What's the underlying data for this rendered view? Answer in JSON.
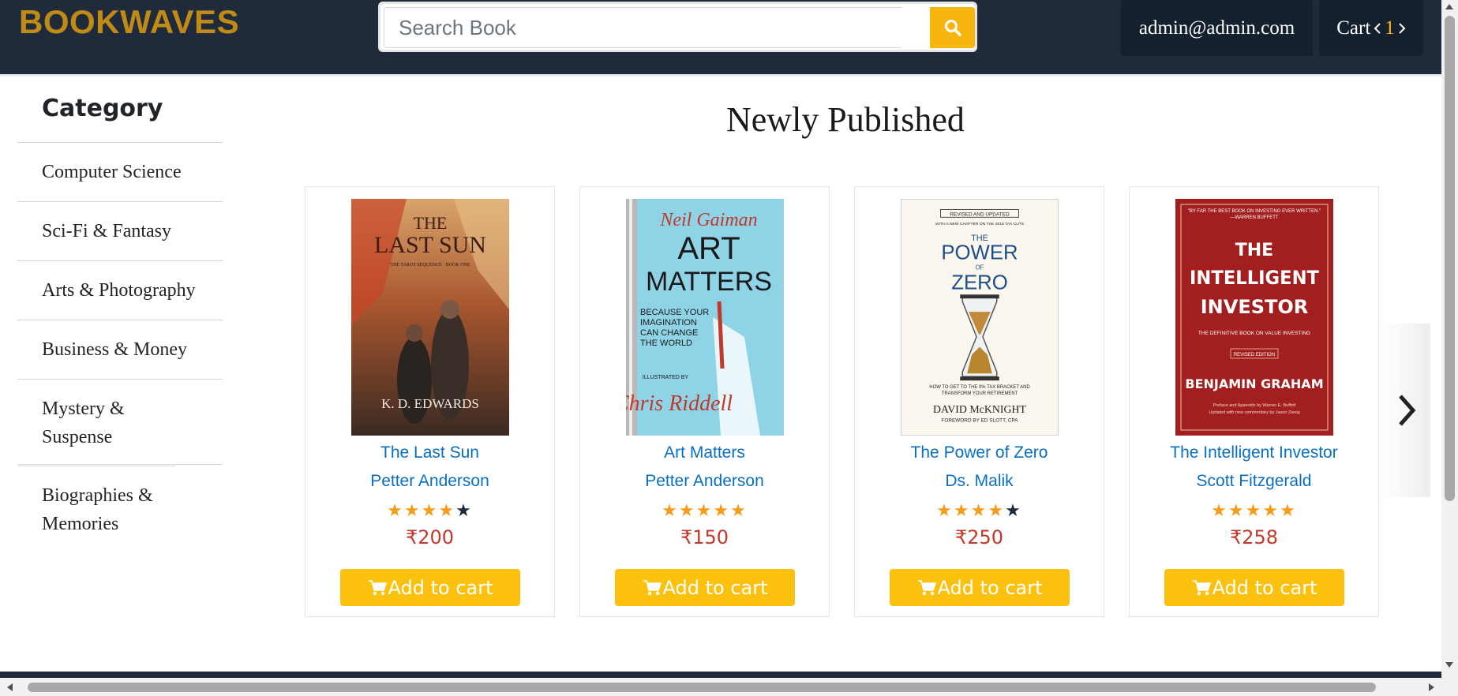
{
  "header": {
    "logo": "BOOKWAVES",
    "search_placeholder": "Search Book",
    "user_email": "admin@admin.com",
    "cart_label": "Cart",
    "cart_count": "1"
  },
  "sidebar": {
    "title": "Category",
    "items": [
      {
        "label": "Computer Science"
      },
      {
        "label": "Sci-Fi & Fantasy"
      },
      {
        "label": "Arts & Photography"
      },
      {
        "label": "Business & Money"
      },
      {
        "label": "Mystery & Suspense"
      },
      {
        "label": "Biographies & Memories"
      }
    ]
  },
  "main": {
    "section_title": "Newly Published",
    "add_to_cart_label": "Add to cart",
    "books": [
      {
        "title": "The Last Sun",
        "author": "Petter Anderson",
        "rating": 4,
        "price": "₹200",
        "cover": {
          "line1": "THE",
          "line2": "LAST SUN",
          "sub": "THE TAROT SEQUENCE · BOOK ONE",
          "author": "K. D. EDWARDS"
        }
      },
      {
        "title": "Art Matters",
        "author": "Petter Anderson",
        "rating": 5,
        "price": "₹150",
        "cover": {
          "line1": "Neil Gaiman",
          "line2": "ART",
          "line3": "MATTERS",
          "sub": "BECAUSE YOUR IMAGINATION CAN CHANGE THE WORLD",
          "illus": "ILLUSTRATED BY",
          "author": "Chris Riddell"
        }
      },
      {
        "title": "The Power of Zero",
        "author": "Ds. Malik",
        "rating": 4,
        "price": "₹250",
        "cover": {
          "badge": "REVISED AND UPDATED",
          "tag": "WITH A NEW CHAPTER ON THE 2018 TAX CUTS",
          "line1": "THE",
          "line2": "POWER",
          "line3": "OF",
          "line4": "ZERO",
          "sub": "HOW TO GET TO THE 0% TAX BRACKET AND TRANSFORM YOUR RETIREMENT",
          "author": "DAVID McKNIGHT",
          "foreword": "FOREWORD BY ED SLOTT, CPA"
        }
      },
      {
        "title": "The Intelligent Investor",
        "author": "Scott Fitzgerald",
        "rating": 5,
        "price": "₹258",
        "cover": {
          "quote": "\"BY FAR THE BEST BOOK ON INVESTING EVER WRITTEN.\" —WARREN BUFFETT",
          "line1": "THE",
          "line2": "INTELLIGENT",
          "line3": "INVESTOR",
          "sub": "THE DEFINITIVE BOOK ON VALUE INVESTING",
          "edition": "REVISED EDITION",
          "author": "BENJAMIN GRAHAM",
          "note": "Preface and Appendix by Warren E. Buffett",
          "note2": "Updated with new commentary by Jason Zweig"
        }
      }
    ]
  },
  "colors": {
    "header_bg": "#1f2a3a",
    "accent": "#f7b50e",
    "link": "#0a6fc2",
    "price": "#c0392b"
  }
}
